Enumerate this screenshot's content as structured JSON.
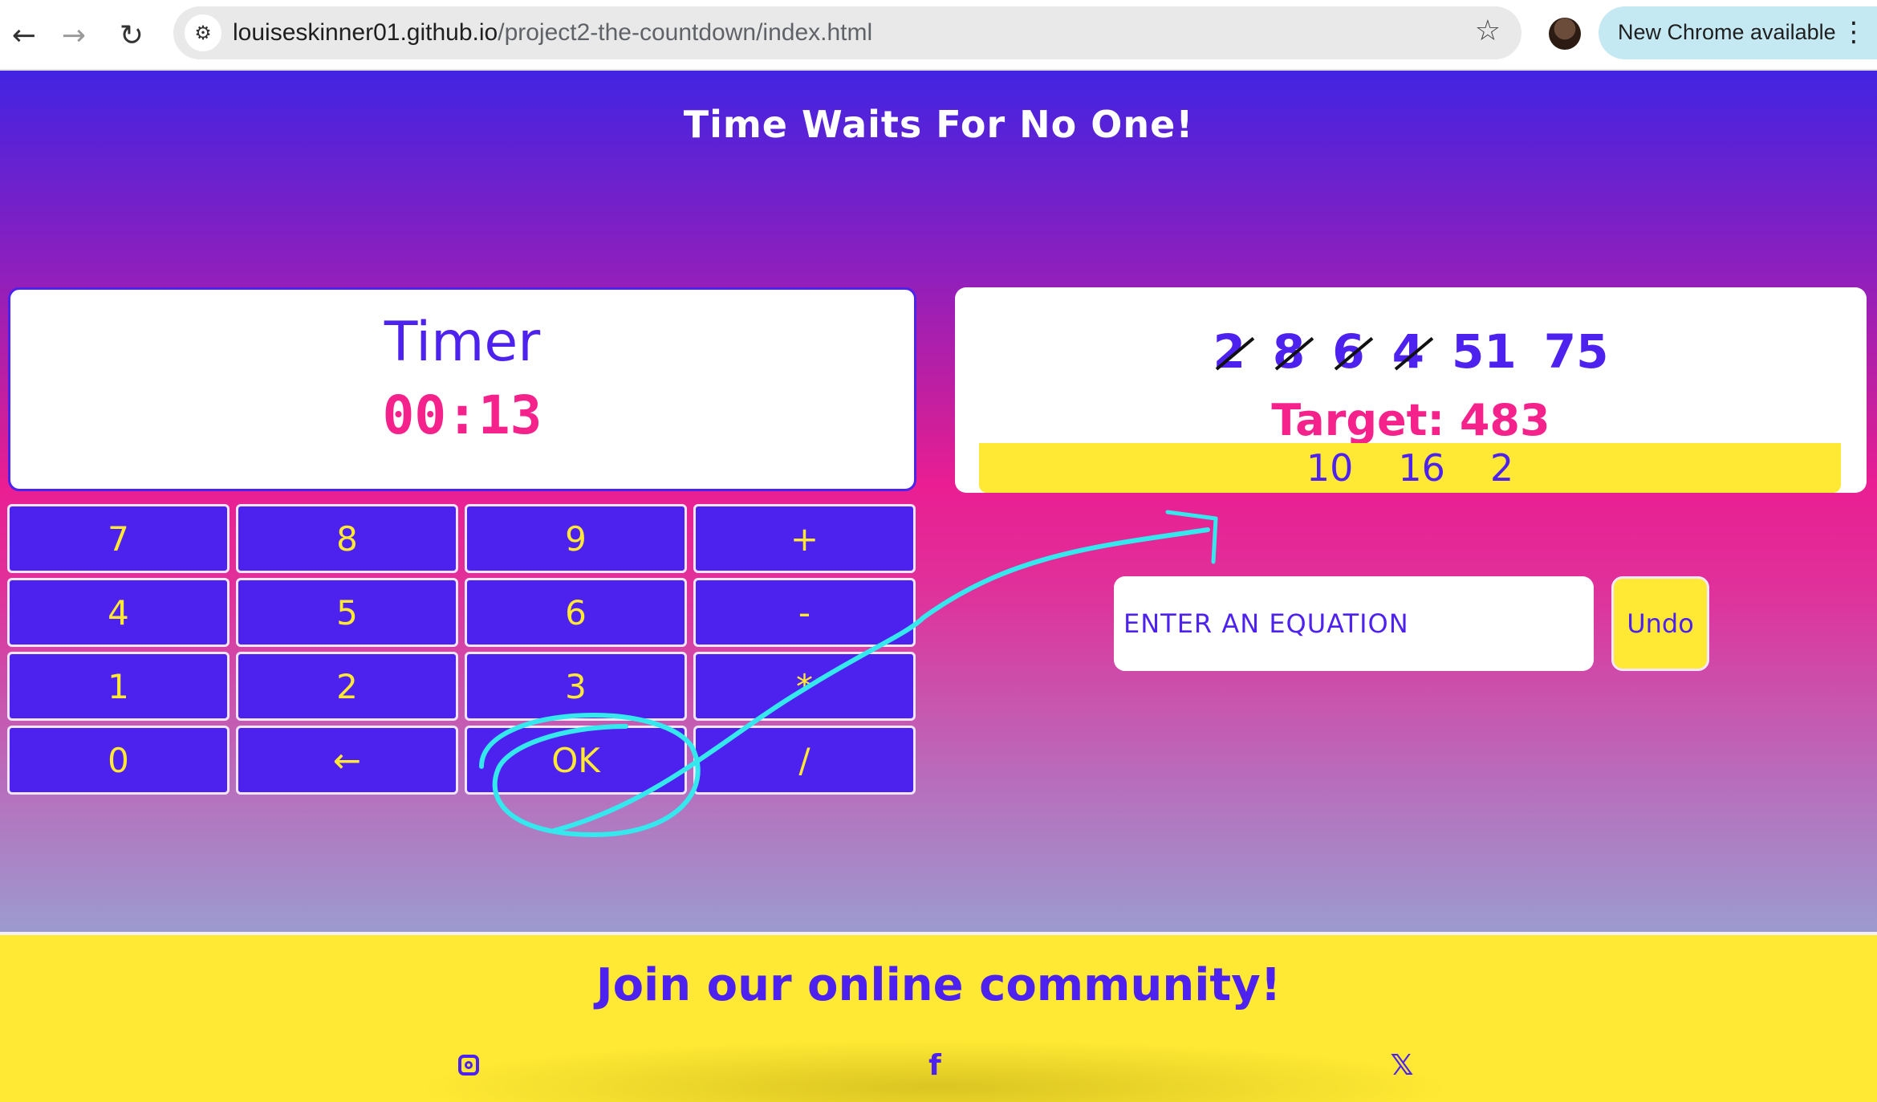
{
  "browser": {
    "back_icon": "back-arrow-icon",
    "forward_icon": "forward-arrow-icon",
    "reload_icon": "reload-icon",
    "site_settings_icon": "tune-icon",
    "url_host": "louiseskinner01.github.io",
    "url_path": "/project2-the-countdown/index.html",
    "bookmark_icon": "star-icon",
    "update_label": "New Chrome available",
    "menu_icon": "kebab-menu-icon"
  },
  "page": {
    "title": "Time Waits For No One!"
  },
  "timer": {
    "label": "Timer",
    "value": "00:13"
  },
  "keypad": {
    "keys": [
      "7",
      "8",
      "9",
      "+",
      "4",
      "5",
      "6",
      "-",
      "1",
      "2",
      "3",
      "*",
      "0",
      "←",
      "OK",
      "/"
    ]
  },
  "game": {
    "numbers": [
      {
        "value": "2",
        "used": true
      },
      {
        "value": "8",
        "used": true
      },
      {
        "value": "6",
        "used": true
      },
      {
        "value": "4",
        "used": true
      },
      {
        "value": "51",
        "used": false
      },
      {
        "value": "75",
        "used": false
      }
    ],
    "target_label": "Target:",
    "target_value": "483",
    "history": [
      "10",
      "16",
      "2"
    ],
    "equation_placeholder": "ENTER AN EQUATION",
    "undo_label": "Undo"
  },
  "footer": {
    "title": "Join our online community!",
    "social_icons": [
      "instagram-icon",
      "facebook-icon",
      "x-icon"
    ]
  },
  "colors": {
    "primary": "#4d22ee",
    "accent": "#ffe934",
    "pink": "#f5228c",
    "annotation": "#34e8ee"
  }
}
